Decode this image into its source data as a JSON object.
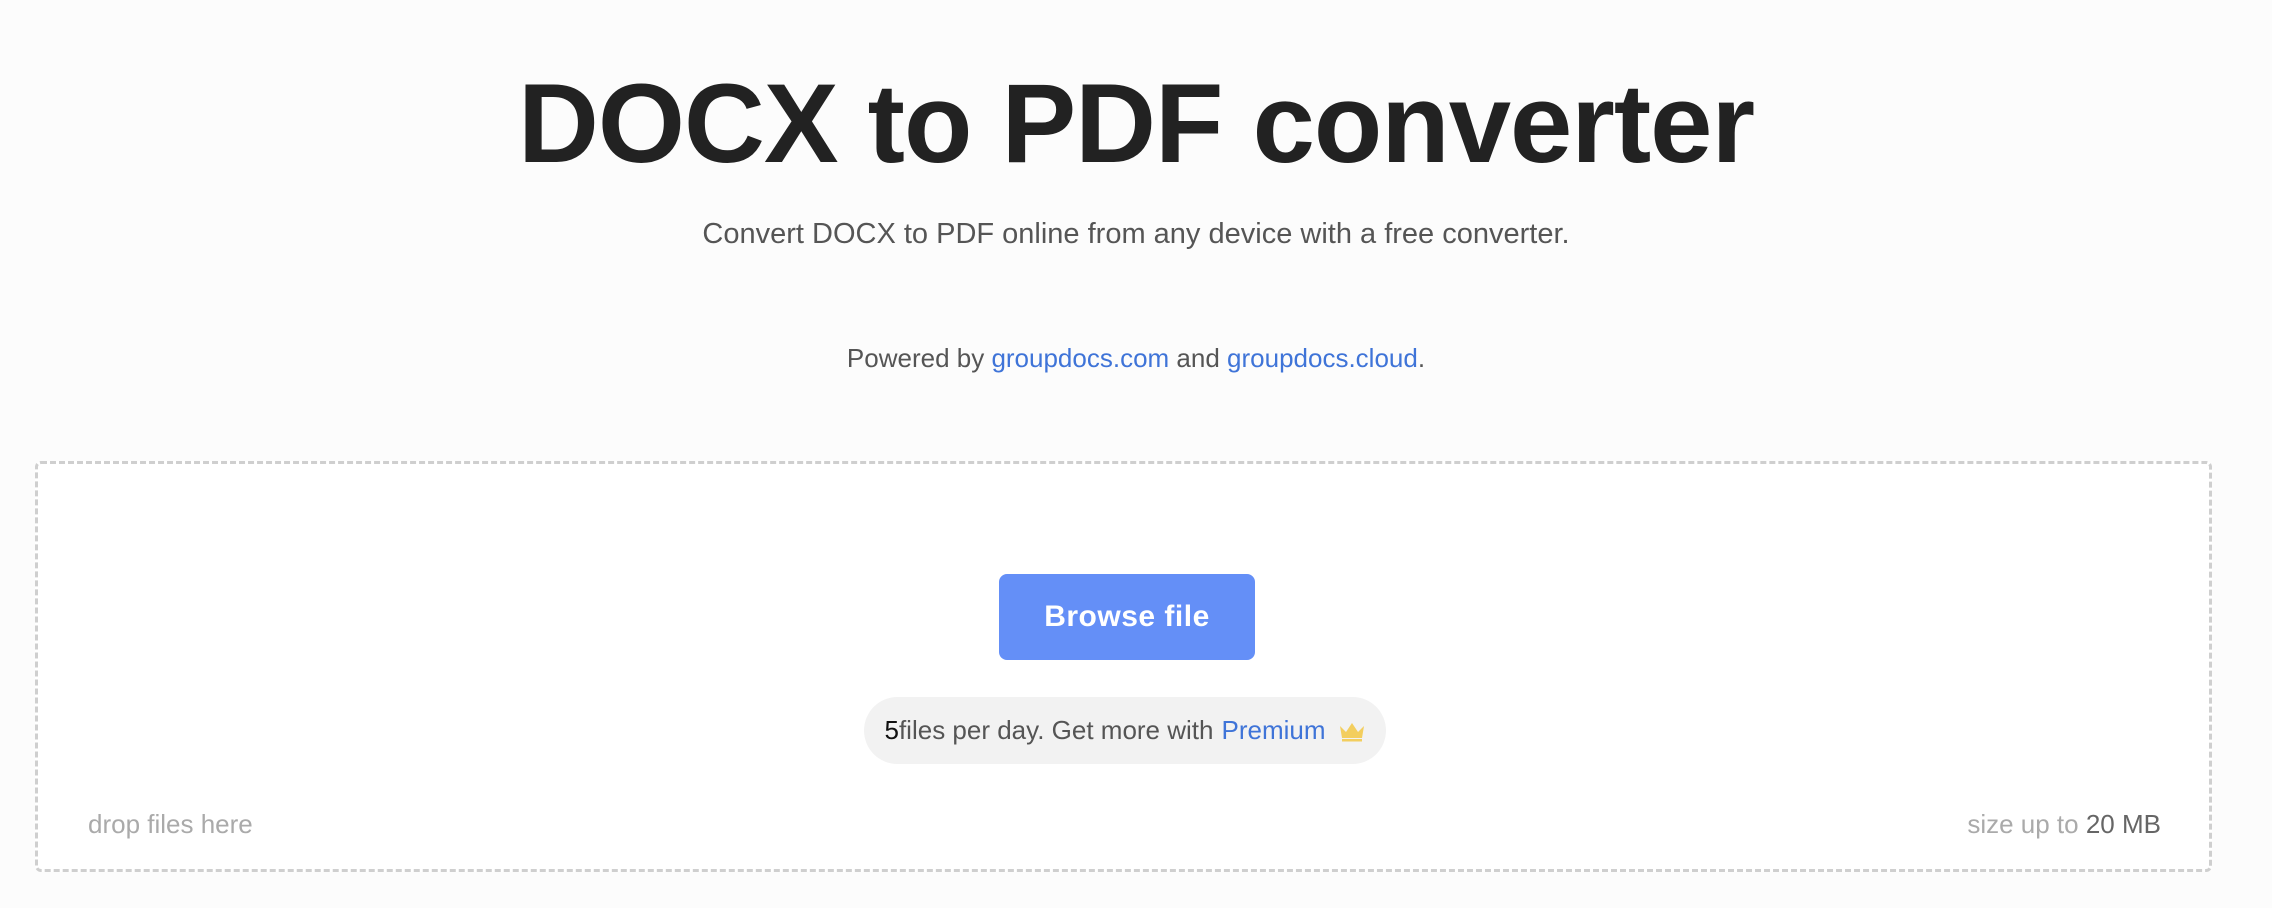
{
  "header": {
    "title": "DOCX to PDF converter",
    "subtitle": "Convert DOCX to PDF online from any device with a free converter."
  },
  "powered": {
    "prefix": "Powered by ",
    "link1": "groupdocs.com",
    "middle": " and ",
    "link2": "groupdocs.cloud",
    "suffix": "."
  },
  "dropzone": {
    "browse_label": "Browse file",
    "quota_count": "5",
    "quota_text": " files per day. Get more with",
    "premium_label": "Premium",
    "premium_icon": "crown-icon",
    "drop_hint": "drop files here",
    "size_prefix": "size up to ",
    "size_value": "20 MB"
  },
  "colors": {
    "accent": "#648ff7",
    "link": "#3f74d8",
    "crown": "#f3ce5e"
  }
}
